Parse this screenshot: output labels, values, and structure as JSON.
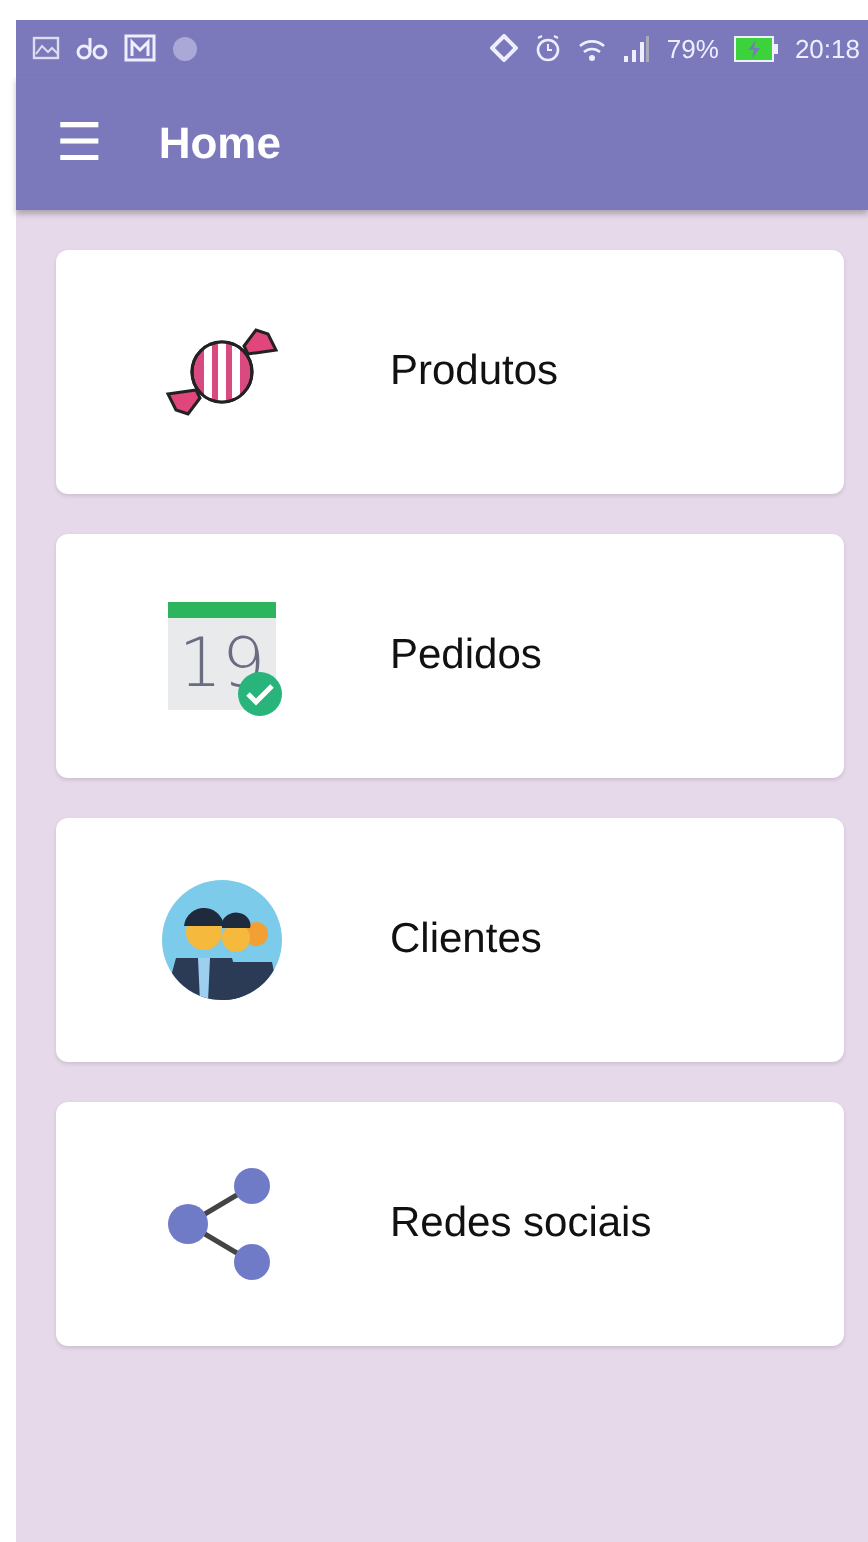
{
  "status_bar": {
    "battery": "79%",
    "time": "20:18"
  },
  "app_bar": {
    "menu_icon": "☰",
    "title": "Home"
  },
  "menu_items": [
    {
      "kind": "candy",
      "label": "Produtos"
    },
    {
      "kind": "calendar",
      "label": "Pedidos",
      "icon_text": "19"
    },
    {
      "kind": "people",
      "label": "Clientes"
    },
    {
      "kind": "share",
      "label": "Redes sociais"
    }
  ]
}
